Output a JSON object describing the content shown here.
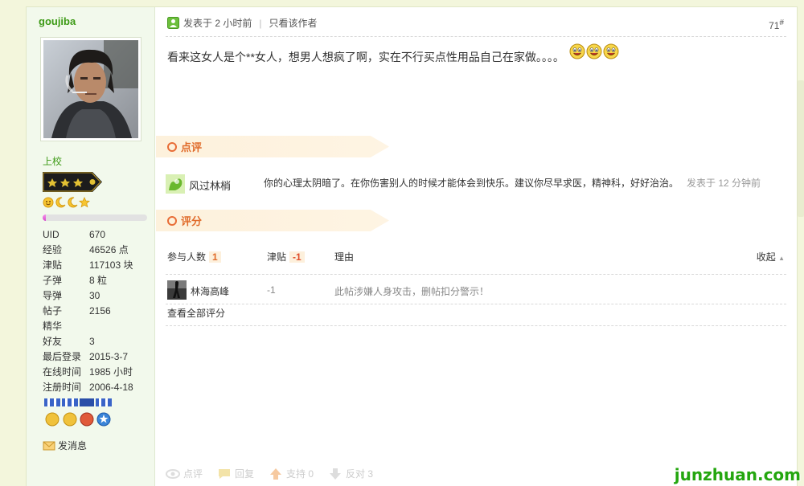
{
  "profile": {
    "username": "goujiba",
    "rank": "上校",
    "credit_progress": 0.03,
    "stats": [
      {
        "k": "UID",
        "v": "670"
      },
      {
        "k": "经验",
        "v": "46526 点"
      },
      {
        "k": "津贴",
        "v": "117103 块"
      },
      {
        "k": "子弹",
        "v": "8 粒"
      },
      {
        "k": "导弹",
        "v": "30"
      },
      {
        "k": "帖子",
        "v": "2156"
      },
      {
        "k": "精华",
        "v": ""
      },
      {
        "k": "好友",
        "v": "3"
      },
      {
        "k": "最后登录",
        "v": "2015-3-7"
      },
      {
        "k": "在线时间",
        "v": "1985 小时"
      },
      {
        "k": "注册时间",
        "v": "2006-4-18"
      }
    ],
    "send_message": "发消息"
  },
  "post": {
    "posted": "发表于 2 小时前",
    "only_author": "只看该作者",
    "floor": "71",
    "floor_mark": "#",
    "content": "看来这女人是个**女人，想男人想疯了啊，实在不行买点性用品自己在家做。。。。"
  },
  "comments": {
    "title": "点评",
    "items": [
      {
        "user": "风过林梢",
        "text": "你的心理太阴暗了。在你伤害别人的时候才能体会到快乐。建议你尽早求医，精神科，好好治治。",
        "time": "发表于 12 分钟前"
      }
    ]
  },
  "rating": {
    "title": "评分",
    "col_participants": "参与人数",
    "participants": "1",
    "col_allowance": "津贴",
    "allowance_total": "-1",
    "col_reason": "理由",
    "collapse": "收起",
    "rows": [
      {
        "user": "林海高峰",
        "score": "-1",
        "reason": "此帖涉嫌人身攻击，删帖扣分警示！"
      }
    ],
    "view_all": "查看全部评分"
  },
  "actions": {
    "comment": "点评",
    "reply": "回复",
    "support": "支持 0",
    "oppose": "反对 3"
  },
  "watermark": "junzhuan.com",
  "colors": {
    "accent_green": "#3d9a16",
    "section_orange": "#e06b2a",
    "watermark_green": "#24a60f"
  }
}
